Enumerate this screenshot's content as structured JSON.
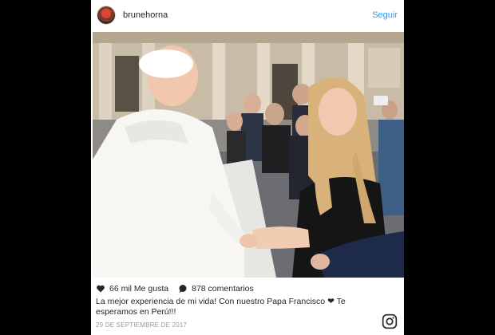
{
  "post": {
    "username": "brunehorna",
    "follow_label": "Seguir",
    "likes": "66 mil Me gusta",
    "comments": "878 comentarios",
    "caption_line1": "La mejor experiencia de mi vida! Con nuestro Papa Francisco ❤ Te",
    "caption_line2": "esperamos en Perú!!!",
    "date": "29 DE SEPTIEMBRE DE 2017"
  },
  "icons": {
    "like": "heart-icon",
    "comment": "comment-bubble-icon",
    "brand": "instagram-icon",
    "avatar": "profile-avatar"
  },
  "colors": {
    "link": "#3897f0",
    "text": "#262626",
    "muted": "#999999",
    "background": "#000000"
  }
}
